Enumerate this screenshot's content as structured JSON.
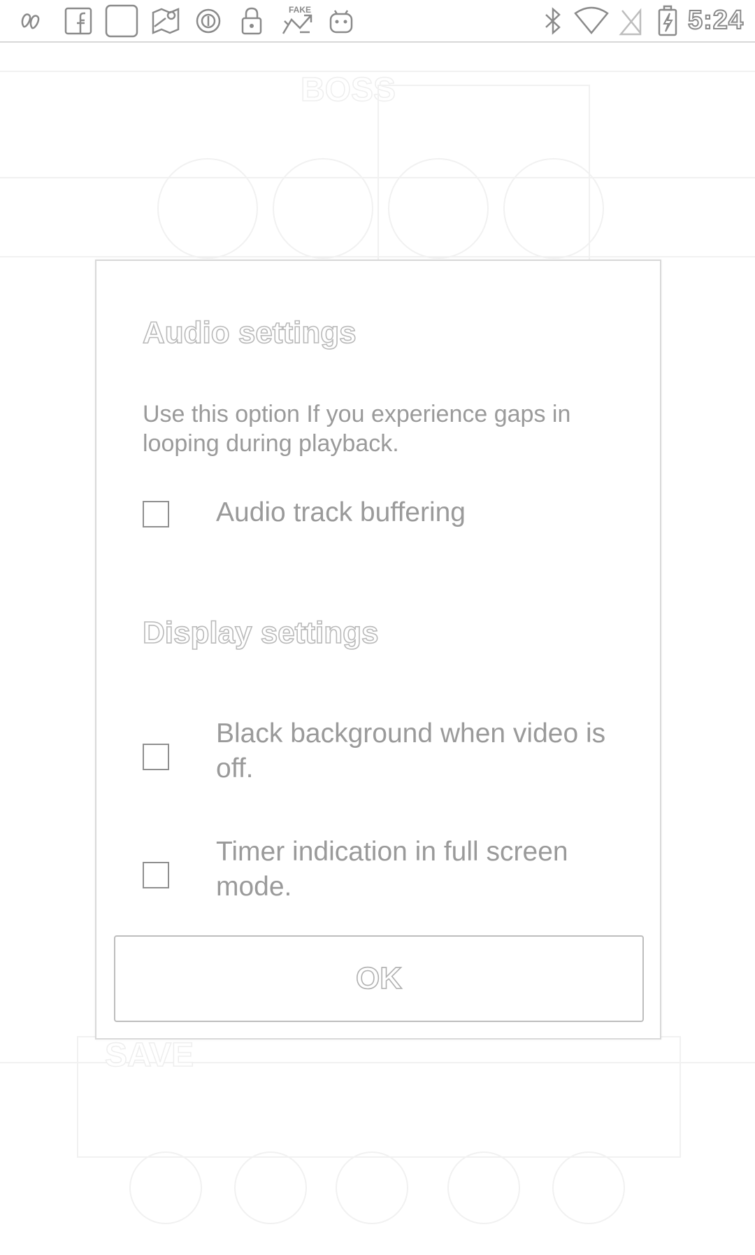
{
  "status_bar": {
    "time": "5:24",
    "left_icons": [
      "link-icon",
      "facebook-icon",
      "blank-square-icon",
      "maps-icon",
      "circle-app-icon",
      "lock-icon",
      "fake-gps-icon",
      "android-icon"
    ],
    "right_icons": [
      "bluetooth-icon",
      "wifi-icon",
      "no-sim-icon",
      "battery-charging-icon"
    ]
  },
  "background_app": {
    "logo_text": "BOSS",
    "promo_text": "SAVE"
  },
  "dialog": {
    "audio_section": {
      "title": "Audio settings",
      "description": "Use this option If you experience gaps in looping during playback.",
      "options": [
        {
          "label": "Audio track buffering",
          "checked": false
        }
      ]
    },
    "display_section": {
      "title": "Display settings",
      "options": [
        {
          "label": "Black background when video is off.",
          "checked": false
        },
        {
          "label": "Timer indication in full screen mode.",
          "checked": false
        }
      ]
    },
    "ok_label": "OK"
  },
  "colors": {
    "text": "#9a9a9a",
    "outline": "#b9b9b9",
    "background": "#ffffff"
  }
}
